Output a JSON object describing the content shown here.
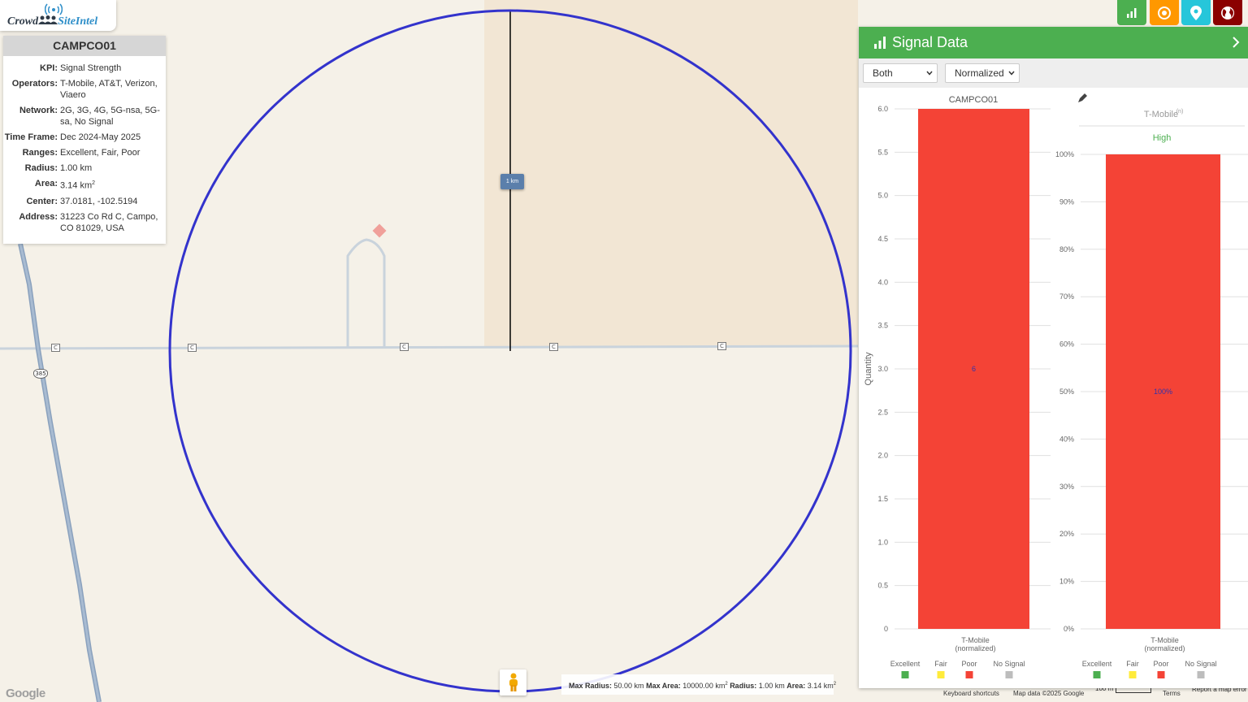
{
  "logo": {
    "part1": "Crowd",
    "part2": "SiteIntel"
  },
  "info": {
    "title": "CAMPCO01",
    "rows": [
      {
        "key": "KPI:",
        "value": "Signal Strength"
      },
      {
        "key": "Operators:",
        "value": "T-Mobile, AT&T, Verizon, Viaero"
      },
      {
        "key": "Network:",
        "value": "2G, 3G, 4G, 5G-nsa, 5G-sa, No Signal"
      },
      {
        "key": "Time Frame:",
        "value": "Dec 2024-May 2025"
      },
      {
        "key": "Ranges:",
        "value": "Excellent, Fair, Poor"
      },
      {
        "key": "Radius:",
        "value": "1.00 km"
      },
      {
        "key": "Area:",
        "value": "3.14 km",
        "sup": "2"
      },
      {
        "key": "Center:",
        "value": "37.0181, -102.5194"
      },
      {
        "key": "Address:",
        "value": "31223 Co Rd C, Campo, CO 81029, USA"
      }
    ]
  },
  "map": {
    "radius_label": "1 km",
    "road_badge": "C",
    "highway_badge": "385",
    "google": "Google",
    "stats": {
      "max_radius_label": "Max Radius:",
      "max_radius": "50.00 km",
      "max_area_label": "Max Area:",
      "max_area": "10000.00 km",
      "radius_label": "Radius:",
      "radius": "1.00 km",
      "area_label": "Area:",
      "area": "3.14 km",
      "sup": "2"
    },
    "attribution": {
      "keyboard": "Keyboard shortcuts",
      "mapdata": "Map data ©2025 Google",
      "scale": "100 m",
      "terms": "Terms",
      "report": "Report a map error"
    }
  },
  "toolbar": {
    "colors": {
      "chart": "#4caf50",
      "target": "#ff9800",
      "pin": "#26c6da",
      "globe": "#8b0000"
    }
  },
  "signal": {
    "title": "Signal Data",
    "select1": "Both",
    "select2": "Normalized"
  },
  "chart_data": [
    {
      "type": "bar",
      "title": "CAMPCO01",
      "ylabel": "Quantity",
      "categories": [
        "T-Mobile\n(normalized)"
      ],
      "category_lines": [
        "T-Mobile",
        "(normalized)"
      ],
      "series": [
        {
          "name": "Poor",
          "values": [
            6
          ]
        }
      ],
      "data_labels": [
        "6"
      ],
      "ylim": [
        0,
        6
      ],
      "yticks": [
        "0",
        "0.5",
        "1.0",
        "1.5",
        "2.0",
        "2.5",
        "3.0",
        "3.5",
        "4.0",
        "4.5",
        "5.0",
        "5.5",
        "6.0"
      ],
      "legend": [
        {
          "name": "Excellent",
          "color": "#4caf50"
        },
        {
          "name": "Fair",
          "color": "#ffeb3b"
        },
        {
          "name": "Poor",
          "color": "#f44336"
        },
        {
          "name": "No Signal",
          "color": "#bdbdbd"
        }
      ],
      "bar_color": "#f44336",
      "grid": true
    },
    {
      "type": "bar",
      "header": "T-Mobile",
      "header_sup": "(n)",
      "subheader": "High",
      "categories": [
        "T-Mobile\n(normalized)"
      ],
      "category_lines": [
        "T-Mobile",
        "(normalized)"
      ],
      "series": [
        {
          "name": "Poor",
          "values": [
            100
          ]
        }
      ],
      "data_labels": [
        "100%"
      ],
      "ylim": [
        0,
        100
      ],
      "yticks": [
        "0%",
        "10%",
        "20%",
        "30%",
        "40%",
        "50%",
        "60%",
        "70%",
        "80%",
        "90%",
        "100%"
      ],
      "legend": [
        {
          "name": "Excellent",
          "color": "#4caf50"
        },
        {
          "name": "Fair",
          "color": "#ffeb3b"
        },
        {
          "name": "Poor",
          "color": "#f44336"
        },
        {
          "name": "No Signal",
          "color": "#bdbdbd"
        }
      ],
      "bar_color": "#f44336",
      "subheader_color": "#4caf50",
      "grid": true
    }
  ]
}
